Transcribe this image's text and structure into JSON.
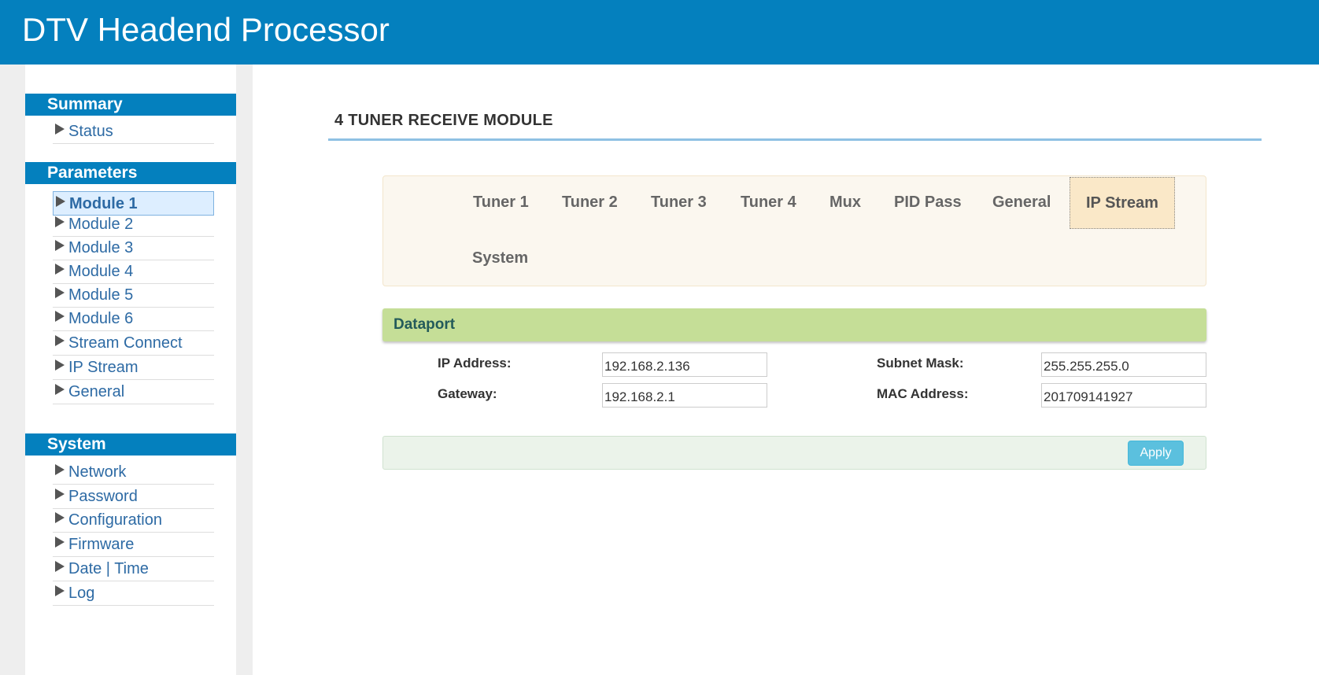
{
  "header": {
    "title": "DTV Headend Processor"
  },
  "sidebar": {
    "summary": {
      "title": "Summary",
      "items": [
        {
          "label": "Status"
        }
      ]
    },
    "parameters": {
      "title": "Parameters",
      "items": [
        {
          "label": "Module 1",
          "active": true
        },
        {
          "label": "Module 2"
        },
        {
          "label": "Module 3"
        },
        {
          "label": "Module 4"
        },
        {
          "label": "Module 5"
        },
        {
          "label": "Module 6"
        },
        {
          "label": "Stream Connect"
        },
        {
          "label": "IP Stream"
        },
        {
          "label": "General"
        }
      ]
    },
    "system": {
      "title": "System",
      "items": [
        {
          "label": "Network"
        },
        {
          "label": "Password"
        },
        {
          "label": "Configuration"
        },
        {
          "label": "Firmware"
        },
        {
          "label": "Date | Time"
        },
        {
          "label": "Log"
        }
      ]
    }
  },
  "main": {
    "title": "4 TUNER RECEIVE MODULE",
    "tabs": [
      {
        "label": "Tuner 1"
      },
      {
        "label": "Tuner 2"
      },
      {
        "label": "Tuner 3"
      },
      {
        "label": "Tuner 4"
      },
      {
        "label": "Mux"
      },
      {
        "label": "PID Pass"
      },
      {
        "label": "General"
      },
      {
        "label": "IP Stream",
        "active": true
      },
      {
        "label": "System"
      }
    ],
    "panel": {
      "title": "Dataport",
      "fields": {
        "ip_address": {
          "label": "IP Address:",
          "value": "192.168.2.136"
        },
        "subnet_mask": {
          "label": "Subnet Mask:",
          "value": "255.255.255.0"
        },
        "gateway": {
          "label": "Gateway:",
          "value": "192.168.2.1"
        },
        "mac_address": {
          "label": "MAC Address:",
          "value": "201709141927"
        }
      }
    },
    "apply_label": "Apply"
  },
  "colors": {
    "header_bg": "#0480be",
    "link": "#2d6aa4",
    "panel_header_bg": "#c5de97",
    "active_tab_bg": "#fae8c8",
    "apply_bg": "#5bc0de"
  }
}
